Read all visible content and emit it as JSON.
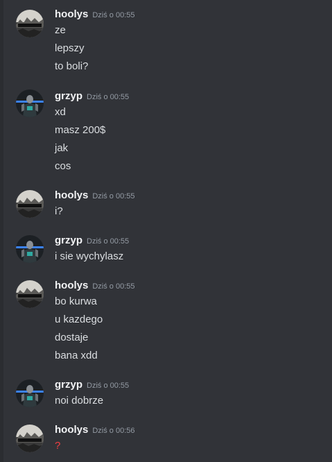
{
  "messages": [
    {
      "author": "hoolys",
      "time": "Dziś o 00:55",
      "avatar": "rocky-landscape-icon",
      "lines": [
        "ze",
        "lepszy",
        "to boli?"
      ]
    },
    {
      "author": "grzyp",
      "time": "Dziś o 00:55",
      "avatar": "person-photo-icon",
      "lines": [
        "xd",
        "masz 200$",
        "jak",
        "cos"
      ]
    },
    {
      "author": "hoolys",
      "time": "Dziś o 00:55",
      "avatar": "rocky-landscape-icon",
      "lines": [
        "i?"
      ]
    },
    {
      "author": "grzyp",
      "time": "Dziś o 00:55",
      "avatar": "person-photo-icon",
      "lines": [
        "i sie wychylasz"
      ]
    },
    {
      "author": "hoolys",
      "time": "Dziś o 00:55",
      "avatar": "rocky-landscape-icon",
      "lines": [
        "bo kurwa",
        "u kazdego",
        "dostaje",
        "bana xdd"
      ]
    },
    {
      "author": "grzyp",
      "time": "Dziś o 00:55",
      "avatar": "person-photo-icon",
      "lines": [
        "noi dobrze"
      ]
    },
    {
      "author": "hoolys",
      "time": "Dziś o 00:56",
      "avatar": "rocky-landscape-icon",
      "lines": [
        "?"
      ],
      "line_color": "#f23f43"
    }
  ],
  "colors": {
    "background": "#313338",
    "username": "#f2f3f5",
    "timestamp": "#949ba4",
    "text": "#dbdee1",
    "accent_red": "#f23f43"
  }
}
